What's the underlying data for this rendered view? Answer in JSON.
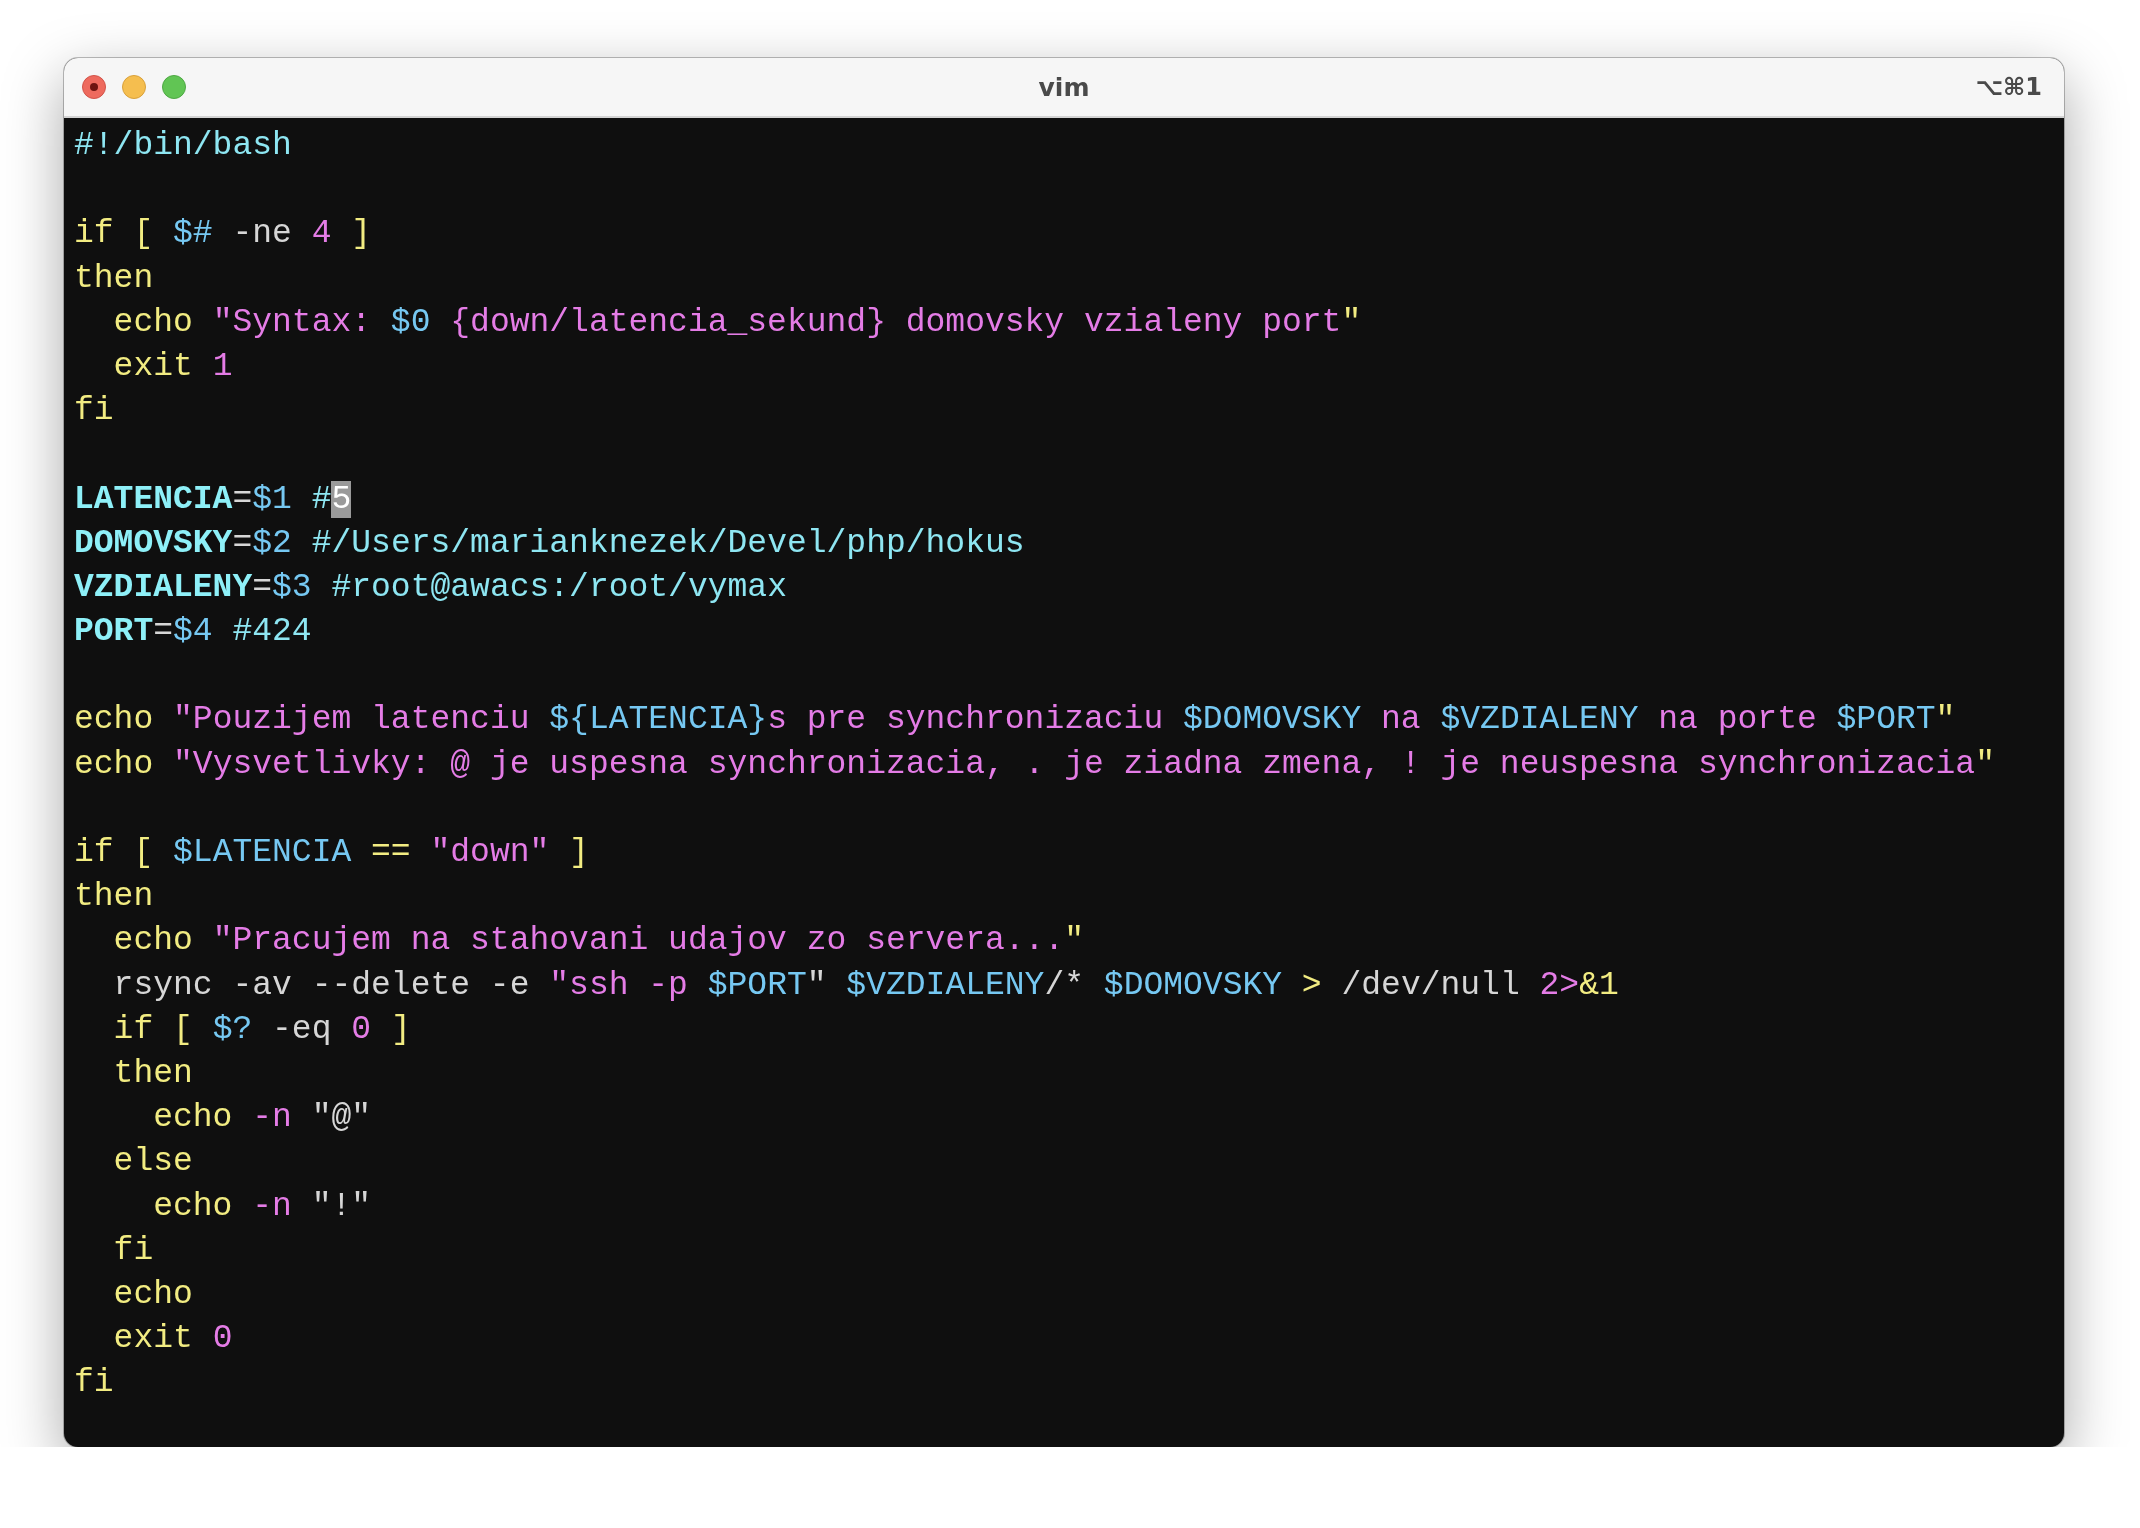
{
  "window": {
    "title": "vim",
    "shortcut": "⌥⌘1"
  },
  "editor": {
    "lines": [
      {
        "kind": "code",
        "tokens": [
          {
            "kind": "comment",
            "text": "#!/bin/bash"
          }
        ]
      },
      {
        "kind": "blank"
      },
      {
        "kind": "code",
        "tokens": [
          {
            "kind": "keyword",
            "text": "if [ "
          },
          {
            "kind": "variable",
            "text": "$#"
          },
          {
            "kind": "plain",
            "text": " -ne "
          },
          {
            "kind": "number",
            "text": "4"
          },
          {
            "kind": "keyword",
            "text": " ]"
          }
        ]
      },
      {
        "kind": "code",
        "tokens": [
          {
            "kind": "keyword",
            "text": "then"
          }
        ]
      },
      {
        "kind": "code",
        "tokens": [
          {
            "kind": "keyword",
            "text": "  echo "
          },
          {
            "kind": "string",
            "text": "\"Syntax: "
          },
          {
            "kind": "variable",
            "text": "$0"
          },
          {
            "kind": "string",
            "text": " {down/latencia_sekund} domovsky vzialeny port"
          },
          {
            "kind": "keyword",
            "text": "\""
          }
        ]
      },
      {
        "kind": "code",
        "tokens": [
          {
            "kind": "keyword",
            "text": "  exit "
          },
          {
            "kind": "number",
            "text": "1"
          }
        ]
      },
      {
        "kind": "code",
        "tokens": [
          {
            "kind": "keyword",
            "text": "fi"
          }
        ]
      },
      {
        "kind": "blank"
      },
      {
        "kind": "code",
        "tokens": [
          {
            "kind": "name",
            "text": "LATENCIA"
          },
          {
            "kind": "plain",
            "text": "="
          },
          {
            "kind": "variable",
            "text": "$1"
          },
          {
            "kind": "comment",
            "text": " #"
          },
          {
            "kind": "cursor",
            "text": "5"
          }
        ]
      },
      {
        "kind": "code",
        "tokens": [
          {
            "kind": "name",
            "text": "DOMOVSKY"
          },
          {
            "kind": "plain",
            "text": "="
          },
          {
            "kind": "variable",
            "text": "$2"
          },
          {
            "kind": "comment",
            "text": " #/Users/marianknezek/Devel/php/hokus"
          }
        ]
      },
      {
        "kind": "code",
        "tokens": [
          {
            "kind": "name",
            "text": "VZDIALENY"
          },
          {
            "kind": "plain",
            "text": "="
          },
          {
            "kind": "variable",
            "text": "$3"
          },
          {
            "kind": "comment",
            "text": " #root@awacs:/root/vymax"
          }
        ]
      },
      {
        "kind": "code",
        "tokens": [
          {
            "kind": "name",
            "text": "PORT"
          },
          {
            "kind": "plain",
            "text": "="
          },
          {
            "kind": "variable",
            "text": "$4"
          },
          {
            "kind": "comment",
            "text": " #424"
          }
        ]
      },
      {
        "kind": "blank"
      },
      {
        "kind": "code",
        "tokens": [
          {
            "kind": "keyword",
            "text": "echo "
          },
          {
            "kind": "string",
            "text": "\"Pouzijem latenciu "
          },
          {
            "kind": "variable",
            "text": "${LATENCIA}"
          },
          {
            "kind": "string",
            "text": "s pre synchronizaciu "
          },
          {
            "kind": "variable",
            "text": "$DOMOVSKY"
          },
          {
            "kind": "string",
            "text": " na "
          },
          {
            "kind": "variable",
            "text": "$VZDIALENY"
          },
          {
            "kind": "string",
            "text": " na porte "
          },
          {
            "kind": "variable",
            "text": "$PORT"
          },
          {
            "kind": "keyword",
            "text": "\""
          }
        ]
      },
      {
        "kind": "code",
        "tokens": [
          {
            "kind": "keyword",
            "text": "echo "
          },
          {
            "kind": "string",
            "text": "\"Vysvetlivky: @ je uspesna synchronizacia, . je ziadna zmena, ! je neuspesna synchronizacia"
          },
          {
            "kind": "keyword",
            "text": "\""
          }
        ]
      },
      {
        "kind": "blank"
      },
      {
        "kind": "code",
        "tokens": [
          {
            "kind": "keyword",
            "text": "if [ "
          },
          {
            "kind": "variable",
            "text": "$LATENCIA"
          },
          {
            "kind": "keyword",
            "text": " == "
          },
          {
            "kind": "string",
            "text": "\"down\""
          },
          {
            "kind": "keyword",
            "text": " ]"
          }
        ]
      },
      {
        "kind": "code",
        "tokens": [
          {
            "kind": "keyword",
            "text": "then"
          }
        ]
      },
      {
        "kind": "code",
        "tokens": [
          {
            "kind": "keyword",
            "text": "  echo "
          },
          {
            "kind": "string",
            "text": "\"Pracujem na stahovani udajov zo servera..."
          },
          {
            "kind": "keyword",
            "text": "\""
          }
        ]
      },
      {
        "kind": "code",
        "tokens": [
          {
            "kind": "plain",
            "text": "  rsync -av --delete -e "
          },
          {
            "kind": "string",
            "text": "\"ssh -p "
          },
          {
            "kind": "variable",
            "text": "$PORT"
          },
          {
            "kind": "plain",
            "text": "\" "
          },
          {
            "kind": "variable",
            "text": "$VZDIALENY"
          },
          {
            "kind": "plain",
            "text": "/* "
          },
          {
            "kind": "variable",
            "text": "$DOMOVSKY"
          },
          {
            "kind": "keyword",
            "text": " > "
          },
          {
            "kind": "plain",
            "text": "/dev/null "
          },
          {
            "kind": "number",
            "text": "2>"
          },
          {
            "kind": "keyword",
            "text": "&1"
          }
        ]
      },
      {
        "kind": "code",
        "tokens": [
          {
            "kind": "keyword",
            "text": "  if [ "
          },
          {
            "kind": "variable",
            "text": "$?"
          },
          {
            "kind": "plain",
            "text": " -eq "
          },
          {
            "kind": "number",
            "text": "0"
          },
          {
            "kind": "keyword",
            "text": " ]"
          }
        ]
      },
      {
        "kind": "code",
        "tokens": [
          {
            "kind": "keyword",
            "text": "  then"
          }
        ]
      },
      {
        "kind": "code",
        "tokens": [
          {
            "kind": "keyword",
            "text": "    echo "
          },
          {
            "kind": "string",
            "text": "-n"
          },
          {
            "kind": "plain",
            "text": " \"@\""
          }
        ]
      },
      {
        "kind": "code",
        "tokens": [
          {
            "kind": "keyword",
            "text": "  else"
          }
        ]
      },
      {
        "kind": "code",
        "tokens": [
          {
            "kind": "keyword",
            "text": "    echo "
          },
          {
            "kind": "string",
            "text": "-n"
          },
          {
            "kind": "plain",
            "text": " \"!\""
          }
        ]
      },
      {
        "kind": "code",
        "tokens": [
          {
            "kind": "keyword",
            "text": "  fi"
          }
        ]
      },
      {
        "kind": "code",
        "tokens": [
          {
            "kind": "keyword",
            "text": "  echo"
          }
        ]
      },
      {
        "kind": "code",
        "tokens": [
          {
            "kind": "keyword",
            "text": "  exit "
          },
          {
            "kind": "number",
            "text": "0"
          }
        ]
      },
      {
        "kind": "code",
        "tokens": [
          {
            "kind": "keyword",
            "text": "fi"
          }
        ]
      }
    ]
  }
}
